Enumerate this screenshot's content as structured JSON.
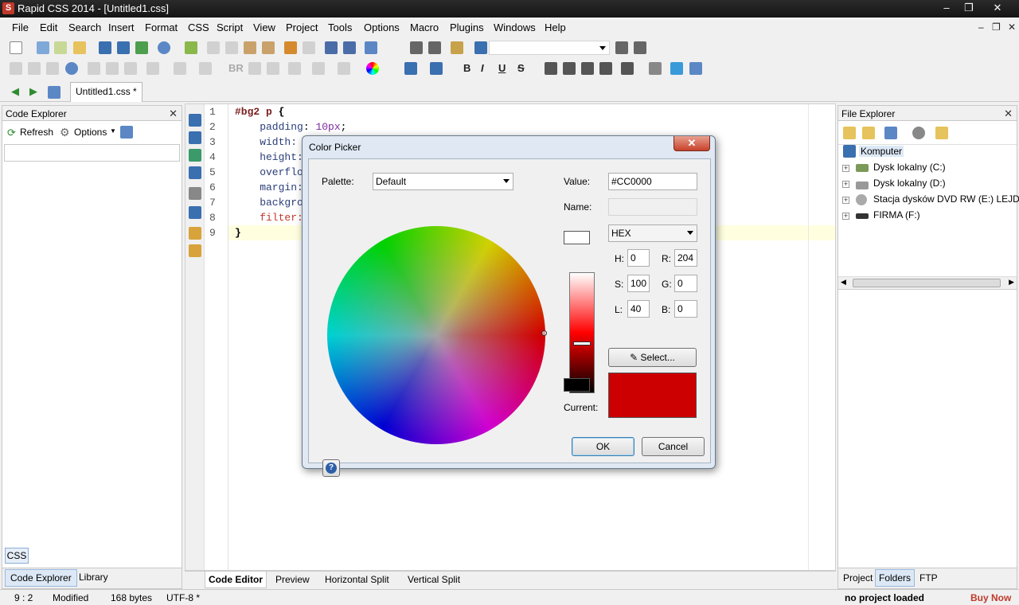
{
  "window": {
    "title": "Rapid CSS 2014 - [Untitled1.css]",
    "app_icon": "S",
    "controls": {
      "minimize": "–",
      "maximize": "❐",
      "close": "✕"
    }
  },
  "menu": [
    "File",
    "Edit",
    "Search",
    "Insert",
    "Format",
    "CSS",
    "Script",
    "View",
    "Project",
    "Tools",
    "Options",
    "Macro",
    "Plugins",
    "Windows",
    "Help"
  ],
  "toolbar2": {
    "br_label": "BR"
  },
  "doc_tab": "Untitled1.css *",
  "code_explorer": {
    "title": "Code Explorer",
    "refresh": "Refresh",
    "options": "Options",
    "css_tab": "CSS",
    "tabs": [
      "Code Explorer",
      "Library"
    ]
  },
  "editor": {
    "lines": [
      {
        "num": "1",
        "parts": [
          {
            "t": "#bg2 p ",
            "c": "#7a1f1f",
            "b": true
          },
          {
            "t": "{",
            "c": "#000",
            "b": true
          }
        ]
      },
      {
        "num": "2",
        "parts": [
          {
            "t": "    padding",
            "c": "#2a3e7a"
          },
          {
            "t": ": ",
            "c": "#000"
          },
          {
            "t": "10px",
            "c": "#7d2aa0"
          },
          {
            "t": ";",
            "c": "#000"
          }
        ]
      },
      {
        "num": "3",
        "parts": [
          {
            "t": "    width:",
            "c": "#2a3e7a"
          }
        ]
      },
      {
        "num": "4",
        "parts": [
          {
            "t": "    height:",
            "c": "#2a3e7a"
          }
        ]
      },
      {
        "num": "5",
        "parts": [
          {
            "t": "    overflo",
            "c": "#2a3e7a"
          }
        ]
      },
      {
        "num": "6",
        "parts": [
          {
            "t": "    margin:",
            "c": "#2a3e7a"
          }
        ]
      },
      {
        "num": "7",
        "parts": [
          {
            "t": "    backgro",
            "c": "#2a3e7a"
          }
        ]
      },
      {
        "num": "8",
        "parts": [
          {
            "t": "    filter:",
            "c": "#c0392b"
          }
        ]
      },
      {
        "num": "9",
        "parts": [
          {
            "t": "}",
            "c": "#000",
            "b": true
          }
        ]
      }
    ],
    "bottom_tabs": [
      "Code Editor",
      "Preview",
      "Horizontal Split",
      "Vertical Split"
    ]
  },
  "file_explorer": {
    "title": "File Explorer",
    "root": "Komputer",
    "items": [
      "Dysk lokalny (C:)",
      "Dysk lokalny (D:)",
      "Stacja dysków DVD RW (E:) LEJDIS",
      "FIRMA (F:)"
    ],
    "tabs": [
      "Project",
      "Folders",
      "FTP"
    ]
  },
  "status": {
    "position": "9 : 2",
    "state": "Modified",
    "size": "168 bytes",
    "encoding": "UTF-8 *",
    "project": "no project loaded",
    "buy": "Buy Now"
  },
  "color_picker": {
    "title": "Color Picker",
    "close": "✕",
    "palette_label": "Palette:",
    "palette_value": "Default",
    "value_label": "Value:",
    "value": "#CC0000",
    "name_label": "Name:",
    "name_value": "",
    "format": "HEX",
    "h_label": "H:",
    "h": "0",
    "s_label": "S:",
    "s": "100",
    "l_label": "L:",
    "l": "40",
    "r_label": "R:",
    "r": "204",
    "g_label": "G:",
    "g": "0",
    "b_label": "B:",
    "b": "0",
    "select_label": "Select...",
    "current_label": "Current:",
    "current_color": "#CC0000",
    "ok": "OK",
    "cancel": "Cancel",
    "help": "?"
  }
}
